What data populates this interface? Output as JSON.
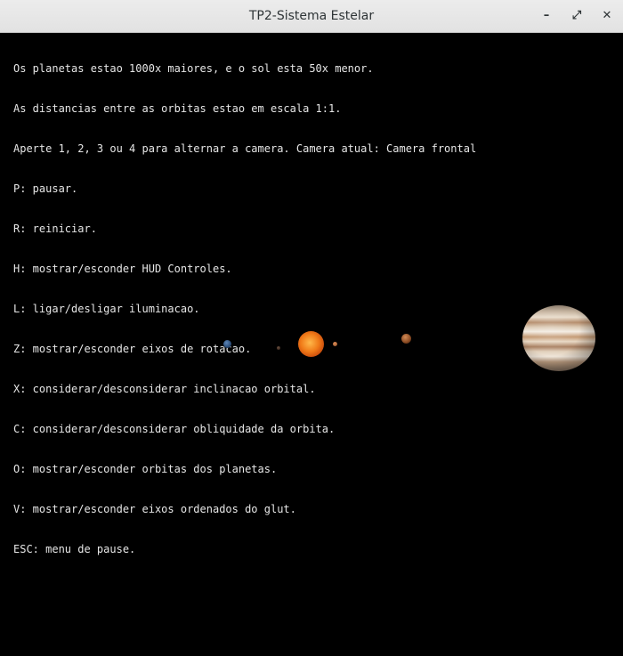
{
  "window": {
    "title": "TP2-Sistema Estelar",
    "buttons": {
      "minimize": "–",
      "maximize": "⤢",
      "close": "✕"
    }
  },
  "hud": {
    "lines": [
      "Os planetas estao 1000x maiores, e o sol esta 50x menor.",
      "As distancias entre as orbitas estao em escala 1:1.",
      "Aperte 1, 2, 3 ou 4 para alternar a camera. Camera atual: Camera frontal",
      "P: pausar.",
      "R: reiniciar.",
      "H: mostrar/esconder HUD Controles.",
      "L: ligar/desligar iluminacao.",
      "Z: mostrar/esconder eixos de rotacao.",
      "X: considerar/desconsiderar inclinacao orbital.",
      "C: considerar/desconsiderar obliquidade da orbita.",
      "O: mostrar/esconder orbitas dos planetas.",
      "V: mostrar/esconder eixos ordenados do glut.",
      "ESC: menu de pause."
    ]
  },
  "scene": {
    "background": "#000000",
    "bodies": [
      "blue-planet",
      "tiny-planet",
      "sun",
      "small-planet",
      "mars-like-planet",
      "jupiter"
    ]
  }
}
